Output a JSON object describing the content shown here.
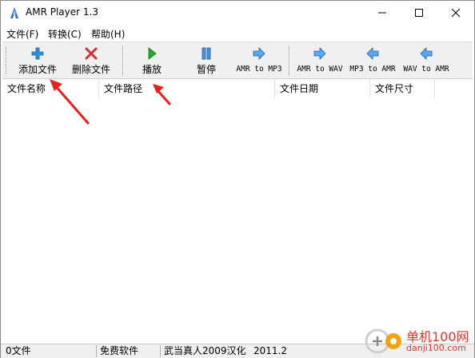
{
  "window": {
    "title": "AMR Player 1.3"
  },
  "menu": {
    "items": [
      "文件(F)",
      "转换(C)",
      "帮助(H)"
    ]
  },
  "toolbar": {
    "add": "添加文件",
    "delete": "删除文件",
    "play": "播放",
    "pause": "暂停",
    "amr_mp3": "AMR to MP3",
    "amr_wav": "AMR to WAV",
    "mp3_amr": "MP3 to AMR",
    "wav_amr": "WAV to AMR"
  },
  "columns": [
    "文件名称",
    "文件路径",
    "文件日期",
    "文件尺寸"
  ],
  "status": {
    "count": "0文件",
    "free": "免费软件",
    "credit": "武当真人2009汉化",
    "version": "2011.2"
  },
  "watermark": {
    "cn": "单机100网",
    "url": "danji100.com"
  },
  "colors": {
    "accent_arrow": "#e8201b",
    "play_green": "#25a828",
    "blue_arrow": "#3b8fe0",
    "delete_red": "#d32f2f"
  }
}
